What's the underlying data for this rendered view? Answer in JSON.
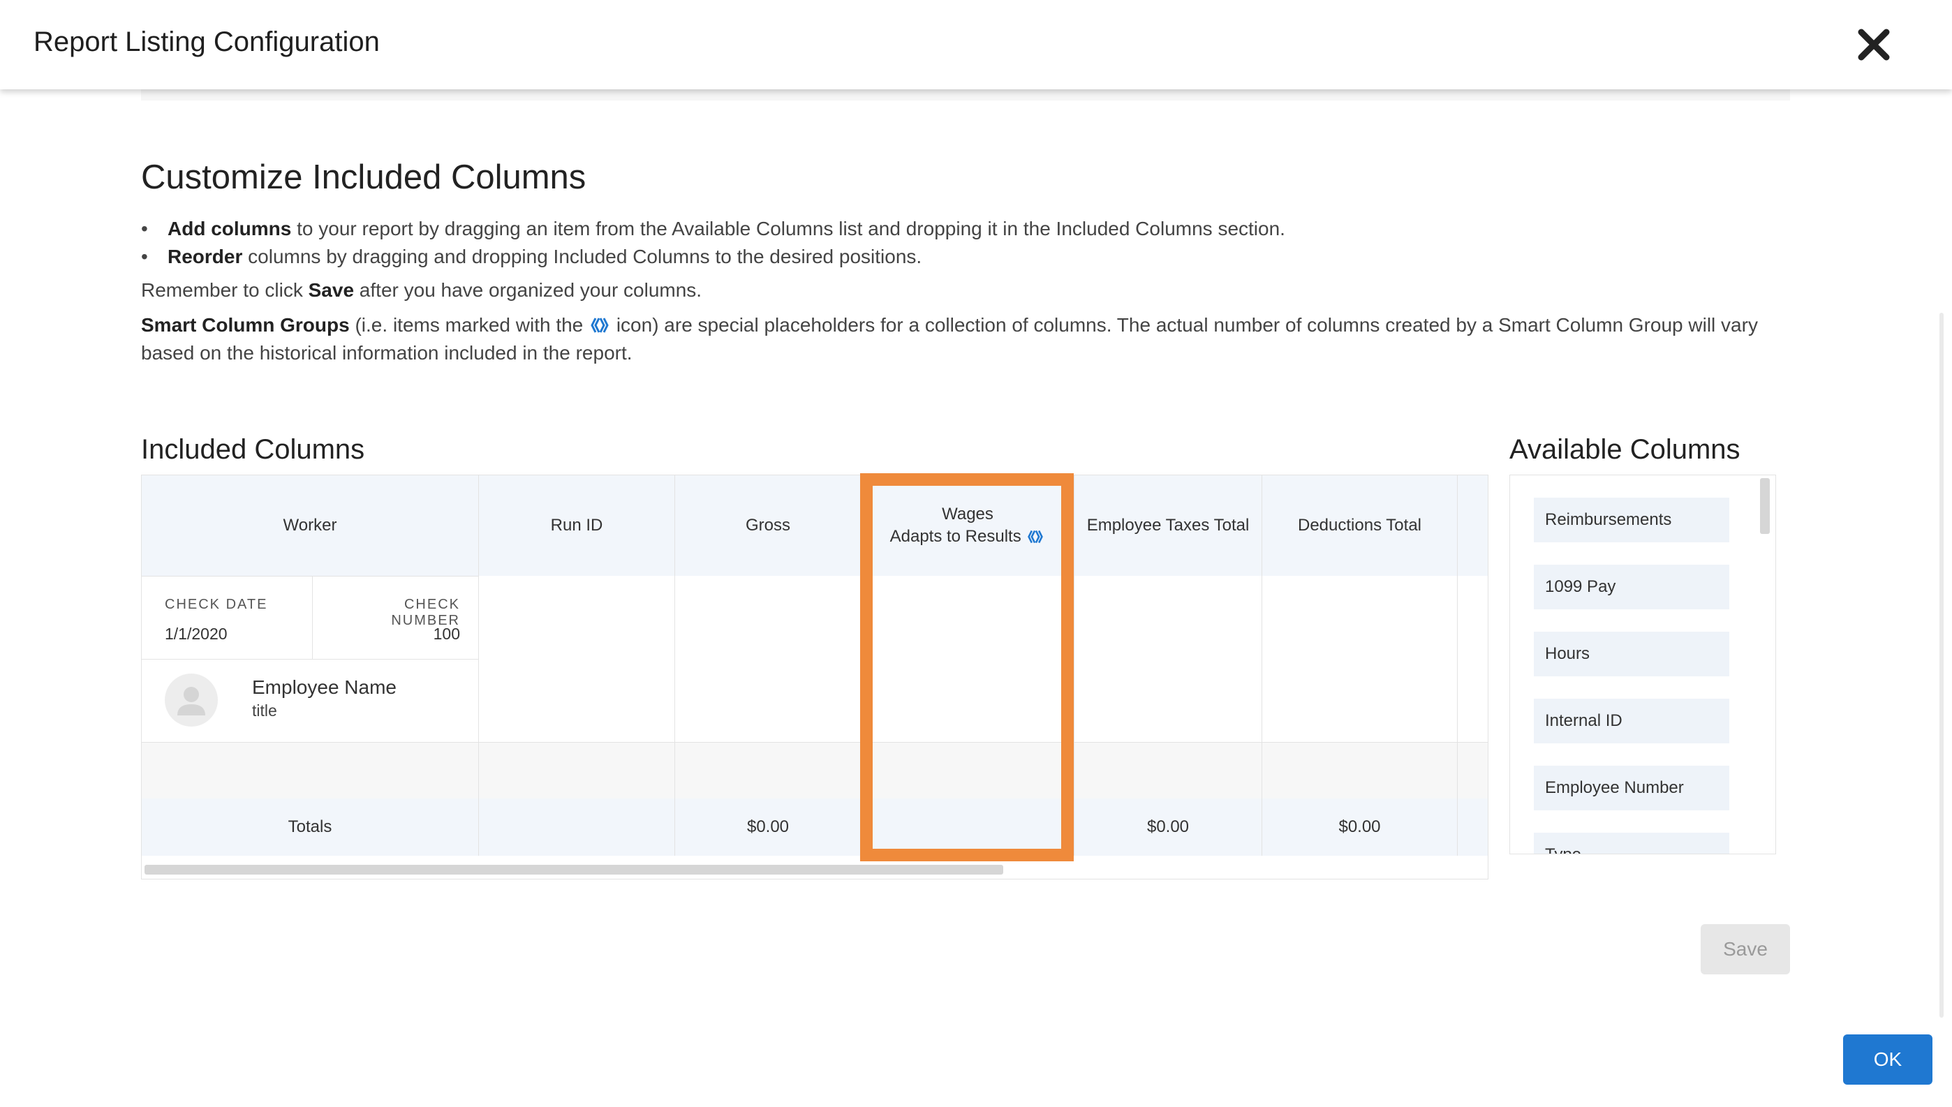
{
  "dialog": {
    "title": "Report Listing Configuration"
  },
  "intro": {
    "heading": "Customize Included Columns",
    "bullet1_bold": "Add columns",
    "bullet1_rest": " to your report by dragging an item from the Available Columns list and dropping it in the Included Columns section.",
    "bullet2_bold": "Reorder",
    "bullet2_rest": " columns by dragging and dropping Included Columns to the desired positions.",
    "remember_pre": "Remember to click ",
    "remember_bold": "Save",
    "remember_post": " after you have organized your columns.",
    "smart_bold": "Smart Column Groups",
    "smart_pre": " (i.e. items marked with the ",
    "smart_post": " icon) are special placeholders for a collection of columns. The actual number of columns created by a Smart Column Group will vary",
    "smart_line2": "based on the historical information included in the report."
  },
  "included": {
    "title": "Included Columns",
    "headers": {
      "worker": "Worker",
      "run_id": "Run ID",
      "gross": "Gross",
      "wages": "Wages",
      "wages_sub": "Adapts to Results",
      "emp_taxes": "Employee Taxes Total",
      "deductions": "Deductions Total"
    },
    "worker_card": {
      "check_date_label": "CHECK DATE",
      "check_date": "1/1/2020",
      "check_number_label": "CHECK NUMBER",
      "check_number": "100",
      "name": "Employee Name",
      "title": "title"
    },
    "totals": {
      "label": "Totals",
      "gross": "$0.00",
      "emp_taxes": "$0.00",
      "deductions": "$0.00"
    }
  },
  "available": {
    "title": "Available Columns",
    "items": [
      "Reimbursements",
      "1099 Pay",
      "Hours",
      "Internal ID",
      "Employee Number",
      "Type"
    ]
  },
  "buttons": {
    "save": "Save",
    "ok": "OK"
  },
  "colors": {
    "highlight": "#ef8a3b",
    "primary": "#1f78d1",
    "smart_icon": "#1f78d1"
  }
}
